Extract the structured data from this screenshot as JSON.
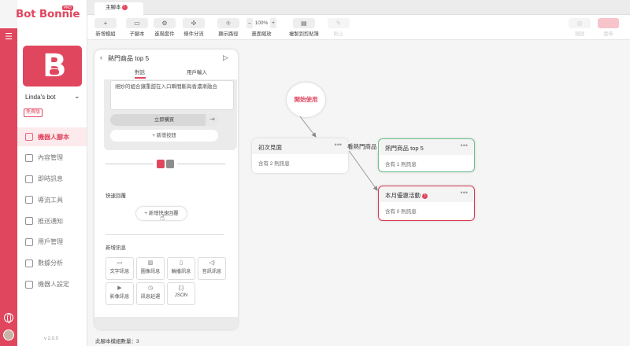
{
  "brand": {
    "name": "Bot Bonnie",
    "badge": "PRO"
  },
  "bot": {
    "name": "Linda's bot",
    "plan": "免費版",
    "logo_letter": "B"
  },
  "nav": {
    "items": [
      {
        "label": "機器人腳本",
        "active": true,
        "icon": "robot-script-icon"
      },
      {
        "label": "內容管理",
        "icon": "content-icon"
      },
      {
        "label": "即時訊息",
        "icon": "chat-icon"
      },
      {
        "label": "導流工具",
        "icon": "funnel-icon"
      },
      {
        "label": "推送通知",
        "icon": "megaphone-icon"
      },
      {
        "label": "用戶管理",
        "icon": "users-icon"
      },
      {
        "label": "數據分析",
        "icon": "chart-icon"
      },
      {
        "label": "機器人設定",
        "icon": "gear-icon"
      }
    ]
  },
  "version": "v 2.0.0",
  "tab": {
    "label": "主腳本",
    "badge": "!"
  },
  "toolbar": {
    "new_module": "新增模組",
    "sub_script": "子腳本",
    "advanced": "進階套件",
    "condition": "條件分流",
    "show_path": "顯示路徑",
    "zoom_minus": "–",
    "zoom_value": "100%",
    "zoom_plus": "+",
    "zoom_label": "畫面縮放",
    "copy": "複製到剪貼簿",
    "paste": "貼上",
    "test": "測試",
    "publish": "發佈"
  },
  "panel": {
    "title": "熱門商品 top 5",
    "tab_dialog": "對話",
    "tab_user_input": "用戶輸入",
    "text_content": "絕妙的組合讓重甜在入口瞬間斷與香濃漸融合",
    "buy_button": "立即購買",
    "add_button": "+ 新增按鈕",
    "quick_reply_label": "快速回覆",
    "quick_reply_button": "+ 新增快速回覆",
    "new_message_label": "新增訊息",
    "message_types": [
      {
        "label": "文字訊息",
        "icon": "text-message-icon",
        "glyph": "▭"
      },
      {
        "label": "圖像訊息",
        "icon": "image-icon",
        "glyph": "▨"
      },
      {
        "label": "輪播訊息",
        "icon": "carousel-icon",
        "glyph": "▯"
      },
      {
        "label": "音訊訊息",
        "icon": "audio-icon",
        "glyph": "◁)"
      },
      {
        "label": "影像訊息",
        "icon": "video-icon",
        "glyph": "▶"
      },
      {
        "label": "訊息延遲",
        "icon": "clock-icon",
        "glyph": "◷"
      },
      {
        "label": "JSON",
        "icon": "json-icon",
        "glyph": "{;}"
      }
    ]
  },
  "canvas": {
    "start_label": "開始使用",
    "edge_label": "看熱門商品",
    "nodes": [
      {
        "title": "初次見面",
        "body": "含有 2 則訊息",
        "more": "•••"
      },
      {
        "title": "熱門商品 top 5",
        "body": "含有 1 則訊息",
        "more": "•••"
      },
      {
        "title": "本月優惠活動",
        "body": "含有 0 則訊息",
        "more": "•••",
        "warn": "!"
      }
    ]
  },
  "footer": {
    "count_text": "此腳本模組數量：3"
  },
  "colors": {
    "accent": "#e0475f",
    "green_border": "#6cbf8e",
    "red_border": "#d9374f"
  }
}
